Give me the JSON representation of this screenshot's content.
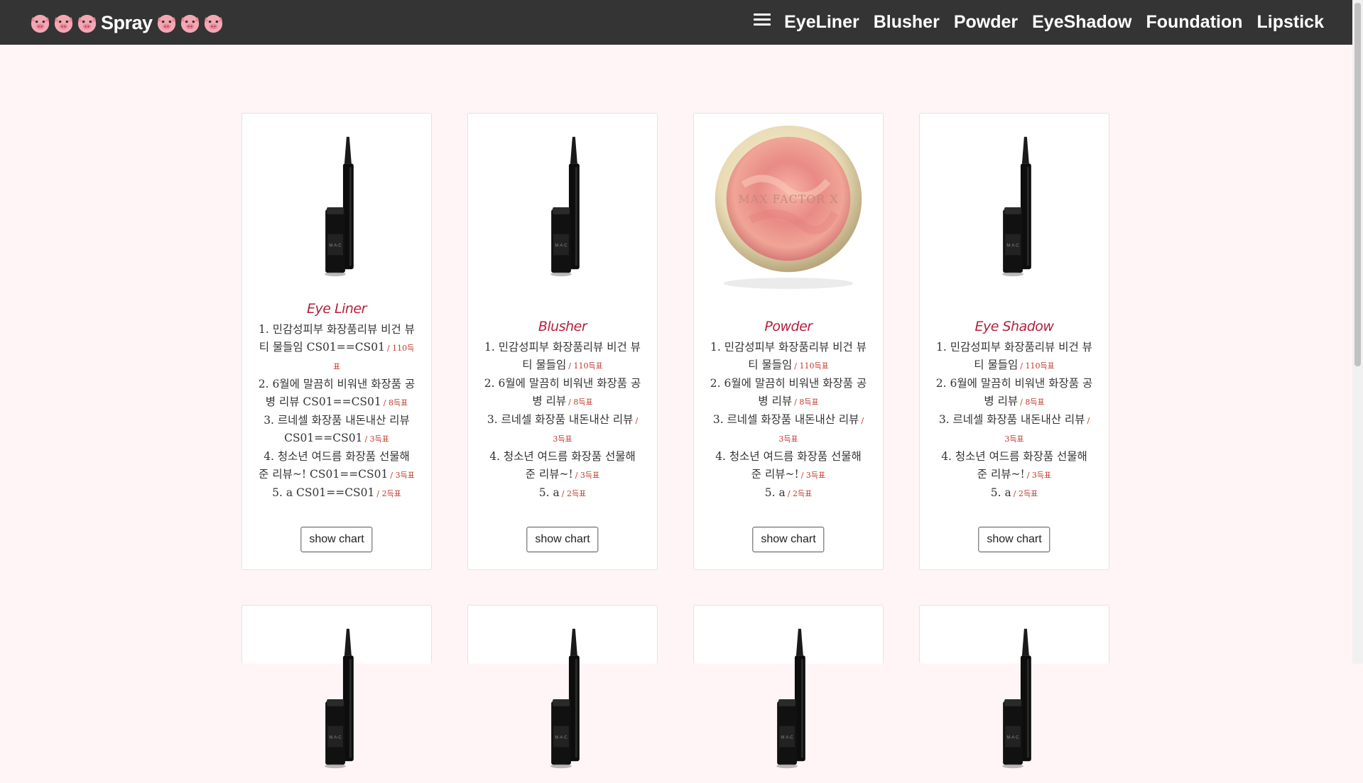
{
  "brand": {
    "label": "Spray"
  },
  "nav": {
    "items": [
      "EyeLiner",
      "Blusher",
      "Powder",
      "EyeShadow",
      "Foundation",
      "Lipstick"
    ]
  },
  "cards": [
    {
      "image": "eyeliner-product-image",
      "title": "Eye Liner",
      "reviews": [
        {
          "text": "1. 민감성피부 화장품리뷰 비건 뷰티 물들임 CS01==CS01",
          "count": "/ 110득표"
        },
        {
          "text": "2. 6월에 말끔히 비워낸 화장품 공병 리뷰 CS01==CS01",
          "count": "/ 8득표"
        },
        {
          "text": "3. 르네셀 화장품 내돈내산 리뷰 CS01==CS01",
          "count": "/ 3득표"
        },
        {
          "text": "4. 청소년 여드름 화장품 선물해 준 리뷰~! CS01==CS01",
          "count": "/ 3득표"
        },
        {
          "text": "5. a CS01==CS01",
          "count": "/ 2득표"
        }
      ],
      "button": "show chart"
    },
    {
      "image": "eyeliner-product-image",
      "title": "Blusher",
      "reviews": [
        {
          "text": "1. 민감성피부 화장품리뷰 비건 뷰티 물들임",
          "count": "/ 110득표"
        },
        {
          "text": "2. 6월에 말끔히 비워낸 화장품 공병 리뷰",
          "count": "/ 8득표"
        },
        {
          "text": "3. 르네셀 화장품 내돈내산 리뷰",
          "count": "/ 3득표"
        },
        {
          "text": "4. 청소년 여드름 화장품 선물해 준 리뷰~!",
          "count": "/ 3득표"
        },
        {
          "text": "5. a",
          "count": "/ 2득표"
        }
      ],
      "button": "show chart"
    },
    {
      "image": "blush-compact-image",
      "title": "Powder",
      "brand_on_image": "MAX FACTOR X",
      "reviews": [
        {
          "text": "1. 민감성피부 화장품리뷰 비건 뷰티 물들임",
          "count": "/ 110득표"
        },
        {
          "text": "2. 6월에 말끔히 비워낸 화장품 공병 리뷰",
          "count": "/ 8득표"
        },
        {
          "text": "3. 르네셀 화장품 내돈내산 리뷰",
          "count": "/ 3득표"
        },
        {
          "text": "4. 청소년 여드름 화장품 선물해 준 리뷰~!",
          "count": "/ 3득표"
        },
        {
          "text": "5. a",
          "count": "/ 2득표"
        }
      ],
      "button": "show chart"
    },
    {
      "image": "eyeliner-product-image",
      "title": "Eye Shadow",
      "reviews": [
        {
          "text": "1. 민감성피부 화장품리뷰 비건 뷰티 물들임",
          "count": "/ 110득표"
        },
        {
          "text": "2. 6월에 말끔히 비워낸 화장품 공병 리뷰",
          "count": "/ 8득표"
        },
        {
          "text": "3. 르네셀 화장품 내돈내산 리뷰",
          "count": "/ 3득표"
        },
        {
          "text": "4. 청소년 여드름 화장품 선물해 준 리뷰~!",
          "count": "/ 3득표"
        },
        {
          "text": "5. a",
          "count": "/ 2득표"
        }
      ],
      "button": "show chart"
    }
  ],
  "colors": {
    "navbar": "#343434",
    "background": "#fff5f6",
    "accent": "#b3203c"
  }
}
